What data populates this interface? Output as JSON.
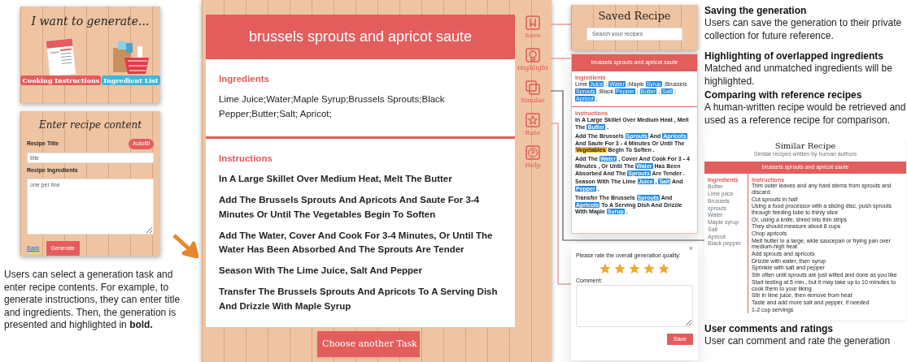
{
  "task_panel": {
    "title": "I want to generate...",
    "options": [
      {
        "label": "Cooking Instructions",
        "kind": "instructions"
      },
      {
        "label": "Ingredient List",
        "kind": "ingredients"
      }
    ]
  },
  "form_panel": {
    "title": "Enter recipe content",
    "autofill": "Autofill",
    "fields": [
      {
        "label": "Recipe Title",
        "placeholder": "title",
        "kind": "single"
      },
      {
        "label": "Recipe Ingredients",
        "placeholder": "one per line",
        "kind": "multi"
      }
    ],
    "back": "Back",
    "generate": "Generate"
  },
  "caption": "Users can select a generation task and enter recipe contents. For example, to generate instructions, they can enter title and ingredients. Then, the generation is presented and highlighted in **bold.**",
  "recipe": {
    "title": "brussels sprouts and apricot saute",
    "sections": [
      {
        "heading": "Ingredients",
        "kind": "plain",
        "lines": [
          "Lime Juice;Water;Maple Syrup;Brussels Sprouts;Black Pepper;Butter;Salt; Apricot;"
        ]
      },
      {
        "heading": "Instructions",
        "kind": "bold",
        "lines": [
          "In A Large Skillet Over Medium Heat, Melt The Butter",
          "Add The Brussels Sprouts And Apricots And Saute For 3-4 Minutes Or Until The Vegetables Begin To Soften",
          "Add The Water, Cover And Cook For 3-4 Minutes, Or Until The Water Has Been Absorbed And The Sprouts Are Tender",
          "Season With The Lime Juice, Salt And Pepper",
          "Transfer The Brussels Sprouts And Apricots To A Serving Dish And Drizzle With Maple Syrup"
        ]
      }
    ],
    "button": "Choose another Task"
  },
  "side_tools": [
    {
      "label": "Save",
      "kind": "save"
    },
    {
      "label": "Highlight",
      "kind": "highlight"
    },
    {
      "label": "Similar",
      "kind": "similar"
    },
    {
      "label": "Rate",
      "kind": "rate"
    },
    {
      "label": "Help",
      "kind": "help"
    }
  ],
  "saved_panel": {
    "title": "Saved Recipe",
    "placeholder": "Search your recipes"
  },
  "highlight_panel": {
    "title": "brussels sprouts and apricot saute",
    "ingredients_heading": "Ingredients",
    "ingredients": [
      {
        "text": "Lime",
        "kind": "plain"
      },
      {
        "text": "Juice",
        "kind": "matched"
      },
      {
        "text": ";",
        "kind": "plain"
      },
      {
        "text": "Water",
        "kind": "matched"
      },
      {
        "text": ";Maple",
        "kind": "plain"
      },
      {
        "text": "Syrup",
        "kind": "matched"
      },
      {
        "text": ";Brussels",
        "kind": "plain"
      },
      {
        "text": "Sprouts",
        "kind": "matched"
      },
      {
        "text": ";Black",
        "kind": "plain"
      },
      {
        "text": "Pepper",
        "kind": "matched"
      },
      {
        "text": ";",
        "kind": "plain"
      },
      {
        "text": "Butter",
        "kind": "matched"
      },
      {
        "text": ";",
        "kind": "plain"
      },
      {
        "text": "Salt",
        "kind": "matched"
      },
      {
        "text": ";",
        "kind": "plain"
      },
      {
        "text": "Apricot",
        "kind": "matched"
      },
      {
        "text": ";",
        "kind": "plain"
      }
    ],
    "instructions_heading": "Instructions",
    "instructions": [
      [
        {
          "text": "In A Large Skillet Over Medium Heat , Melt The",
          "kind": "plain"
        },
        {
          "text": "Butter",
          "kind": "matched"
        },
        {
          "text": ".",
          "kind": "plain"
        }
      ],
      [
        {
          "text": "Add The Brussels",
          "kind": "plain"
        },
        {
          "text": "Sprouts",
          "kind": "matched"
        },
        {
          "text": "And",
          "kind": "plain"
        },
        {
          "text": "Apricots",
          "kind": "matched"
        },
        {
          "text": "And Saute For 3 - 4 Minutes Or Until The",
          "kind": "plain"
        },
        {
          "text": "Vegetables",
          "kind": "unmatched"
        },
        {
          "text": "Begin To Soften .",
          "kind": "plain"
        }
      ],
      [
        {
          "text": "Add The",
          "kind": "plain"
        },
        {
          "text": "Water",
          "kind": "matched"
        },
        {
          "text": ", Cover And Cook For 3 - 4 Minutes , Or Until The",
          "kind": "plain"
        },
        {
          "text": "Water",
          "kind": "matched"
        },
        {
          "text": "Has Been Absorbed And The",
          "kind": "plain"
        },
        {
          "text": "Sprouts",
          "kind": "matched"
        },
        {
          "text": "Are Tender .",
          "kind": "plain"
        }
      ],
      [
        {
          "text": "Season With The Lime",
          "kind": "plain"
        },
        {
          "text": "Juice",
          "kind": "matched"
        },
        {
          "text": ",",
          "kind": "plain"
        },
        {
          "text": "Salt",
          "kind": "matched"
        },
        {
          "text": "And",
          "kind": "plain"
        },
        {
          "text": "Pepper",
          "kind": "matched"
        },
        {
          "text": ".",
          "kind": "plain"
        }
      ],
      [
        {
          "text": "Transfer The Brussels",
          "kind": "plain"
        },
        {
          "text": "Sprouts",
          "kind": "matched"
        },
        {
          "text": "And",
          "kind": "plain"
        },
        {
          "text": "Apricots",
          "kind": "matched"
        },
        {
          "text": "To A Serving Dish And Drizzle With Maple",
          "kind": "plain"
        },
        {
          "text": "Syrup",
          "kind": "matched"
        },
        {
          "text": ".",
          "kind": "plain"
        }
      ]
    ]
  },
  "annotations": [
    {
      "heading": "Saving the generation",
      "body": "Users can save the generation to their private collection for future reference."
    },
    {
      "heading": "Highlighting of overlapped ingredients",
      "body": "Matched and unmatched ingredients will be highlighted."
    },
    {
      "heading": "Comparing with reference recipes",
      "body": "A human-written recipe would be retrieved and used as a reference recipe for comparison."
    },
    {
      "heading": "User comments and ratings",
      "body": "User can comment and rate the generation"
    }
  ],
  "similar_panel": {
    "title": "Similar Recipe",
    "subtitle": "Similar recipes written by human authors",
    "recipe_title": "brussels sprouts and apricot saute",
    "ingredients_heading": "Ingredients",
    "ingredients": [
      "Butter",
      "Lime juice",
      "Brussels sprouts",
      "Water",
      "Maple syrup",
      "Salt",
      "Apricot",
      "Black pepper"
    ],
    "instructions_heading": "Instructions",
    "instructions": [
      "Trim outer leaves and any hard stems from sprouts and discard",
      "Cut sprouts in half",
      "Using a food processor with a slicing disc, push sprouts through feeding tube to thinly slice",
      "Or, using a knife, shred into thin strips",
      "They should measure about 8 cups",
      "Chop apricots",
      "Melt butter in a large, wide saucepan or frying pan over medium-high heat",
      "Add sprouts and apricots",
      "Drizzle with water, then syrup",
      "Sprinkle with salt and pepper",
      "Stir often until sprouts are just wilted and done as you like",
      "Start testing at 5 min., but it may take up to 10 minutes to cook them to your liking",
      "Stir in lime juice, then remove from heat",
      "Taste and add more salt and pepper, if needed",
      "1-2 cup servings"
    ]
  },
  "rating_dialog": {
    "close": "×",
    "prompt": "Please rate the overall generation quality:",
    "stars": 5,
    "comment_label": "Comment:",
    "save": "Save"
  }
}
